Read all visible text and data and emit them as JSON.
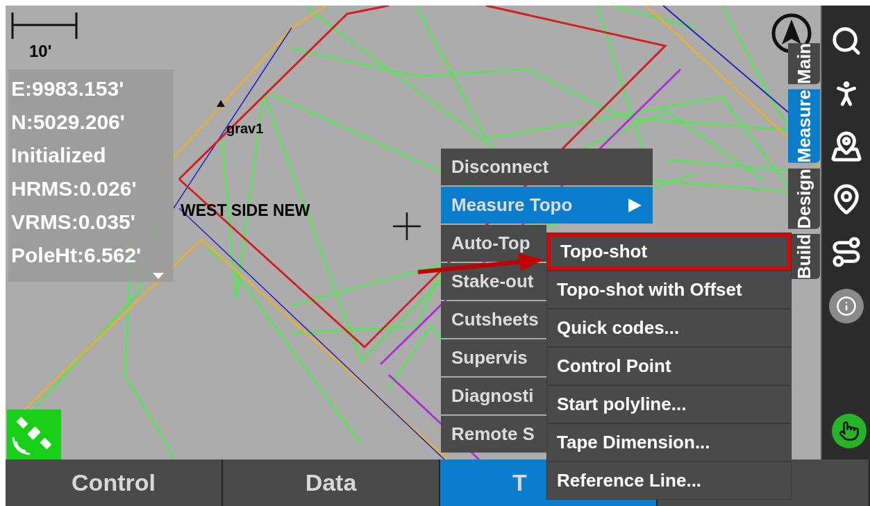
{
  "scale_bar": {
    "label": "10'"
  },
  "status_panel": {
    "lines": [
      "E:9983.153'",
      "N:5029.206'",
      "Initialized",
      "HRMS:0.026'",
      "VRMS:0.035'",
      "PoleHt:6.562'"
    ]
  },
  "map_labels": [
    {
      "text": "grav1",
      "kind": "point"
    },
    {
      "text": "WEST SIDE NEW",
      "kind": "boundary"
    }
  ],
  "side_tabs": [
    {
      "label": "Main",
      "selected": false
    },
    {
      "label": "Measure",
      "selected": true
    },
    {
      "label": "Design",
      "selected": false
    },
    {
      "label": "Build",
      "selected": false
    }
  ],
  "main_menu": [
    {
      "label": "Disconnect",
      "selected": false,
      "has_submenu": false
    },
    {
      "label": "Measure Topo",
      "selected": true,
      "has_submenu": true
    },
    {
      "label": "Auto-Top",
      "selected": false,
      "has_submenu": false
    },
    {
      "label": "Stake-out",
      "selected": false,
      "has_submenu": false
    },
    {
      "label": "Cutsheets",
      "selected": false,
      "has_submenu": false
    },
    {
      "label": "Supervis",
      "selected": false,
      "has_submenu": false
    },
    {
      "label": "Diagnosti",
      "selected": false,
      "has_submenu": false
    },
    {
      "label": "Remote S",
      "selected": false,
      "has_submenu": false
    }
  ],
  "submenu": [
    {
      "label": "Topo-shot",
      "highlighted": true
    },
    {
      "label": "Topo-shot with Offset",
      "highlighted": false
    },
    {
      "label": "Quick codes...",
      "highlighted": false
    },
    {
      "label": "Control Point",
      "highlighted": false
    },
    {
      "label": "Start polyline...",
      "highlighted": false
    },
    {
      "label": "Tape Dimension...",
      "highlighted": false
    },
    {
      "label": "Reference Line...",
      "highlighted": false
    }
  ],
  "bottom_tabs": [
    {
      "label": "Control",
      "selected": false
    },
    {
      "label": "Data",
      "selected": false
    },
    {
      "label": "T",
      "selected": true
    },
    {
      "selected": false
    }
  ]
}
